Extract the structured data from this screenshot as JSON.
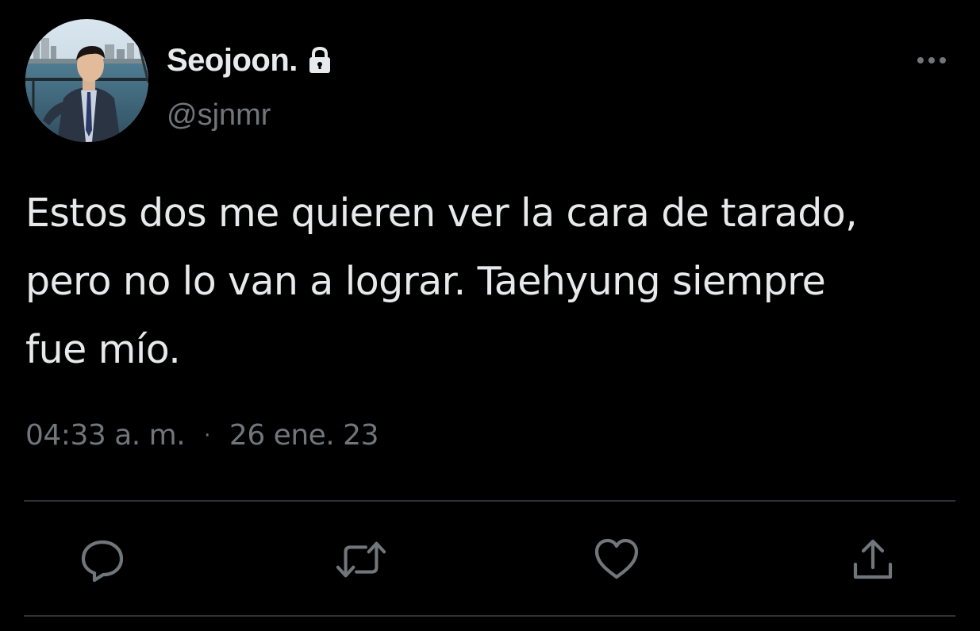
{
  "tweet": {
    "display_name": "Seojoon.",
    "handle": "@sjnmr",
    "text": "Estos dos me quieren ver la cara de tarado,\npero no lo van a lograr. Taehyung siempre\nfue mío.",
    "time": "04:33 a. m.",
    "separator": "·",
    "date": "26 ene. 23"
  },
  "icons": {
    "lock": "lock-icon",
    "more": "more-icon",
    "reply": "reply-icon",
    "retweet": "retweet-icon",
    "like": "heart-icon",
    "share": "share-icon"
  },
  "colors": {
    "background": "#000000",
    "text_primary": "#e7e9ea",
    "text_secondary": "#71767b",
    "divider": "#2f3336"
  }
}
